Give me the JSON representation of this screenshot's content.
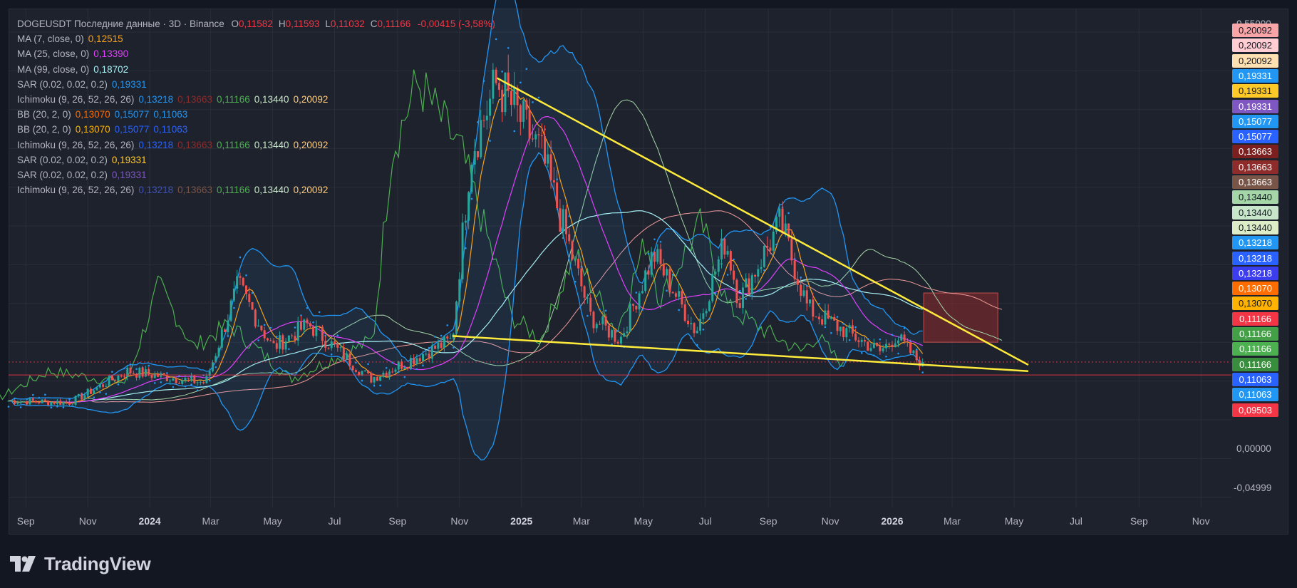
{
  "header": {
    "symbol_line": "DOGEUSDT Последние данные · 3D · Binance",
    "ohlc": [
      {
        "label": "O",
        "value": "0,11582"
      },
      {
        "label": "H",
        "value": "0,11593"
      },
      {
        "label": "L",
        "value": "0,11032"
      },
      {
        "label": "C",
        "value": "0,11166"
      }
    ],
    "change": "-0,00415 (-3,58%)",
    "change_color": "#f23645"
  },
  "indicators": [
    {
      "name": "MA (7, close, 0)",
      "values": [
        {
          "v": "0,12515",
          "c": "#f7a21b"
        }
      ]
    },
    {
      "name": "MA (25, close, 0)",
      "values": [
        {
          "v": "0,13390",
          "c": "#e040fb"
        }
      ]
    },
    {
      "name": "MA (99, close, 0)",
      "values": [
        {
          "v": "0,18702",
          "c": "#a5f0f5"
        }
      ]
    },
    {
      "name": "SAR (0.02, 0.02, 0.2)",
      "values": [
        {
          "v": "0,19331",
          "c": "#2196f3"
        }
      ]
    },
    {
      "name": "Ichimoku (9, 26, 52, 26, 26)",
      "values": [
        {
          "v": "0,13218",
          "c": "#2196f3"
        },
        {
          "v": "0,13663",
          "c": "#8e2b2b"
        },
        {
          "v": "0,11166",
          "c": "#4caf50"
        },
        {
          "v": "0,13440",
          "c": "#c8e6c9"
        },
        {
          "v": "0,20092",
          "c": "#ffcc80"
        }
      ]
    },
    {
      "name": "BB (20, 2, 0)",
      "values": [
        {
          "v": "0,13070",
          "c": "#ff6d00"
        },
        {
          "v": "0,15077",
          "c": "#2196f3"
        },
        {
          "v": "0,11063",
          "c": "#2196f3"
        }
      ]
    },
    {
      "name": "BB (20, 2, 0)",
      "values": [
        {
          "v": "0,13070",
          "c": "#ffb300"
        },
        {
          "v": "0,15077",
          "c": "#2962ff"
        },
        {
          "v": "0,11063",
          "c": "#2962ff"
        }
      ]
    },
    {
      "name": "Ichimoku (9, 26, 52, 26, 26)",
      "values": [
        {
          "v": "0,13218",
          "c": "#2962ff"
        },
        {
          "v": "0,13663",
          "c": "#8e2b2b"
        },
        {
          "v": "0,11166",
          "c": "#4caf50"
        },
        {
          "v": "0,13440",
          "c": "#c8e6c9"
        },
        {
          "v": "0,20092",
          "c": "#ffcc80"
        }
      ]
    },
    {
      "name": "SAR (0.02, 0.02, 0.2)",
      "values": [
        {
          "v": "0,19331",
          "c": "#ffca28"
        }
      ]
    },
    {
      "name": "SAR (0.02, 0.02, 0.2)",
      "values": [
        {
          "v": "0,19331",
          "c": "#7e57c2"
        }
      ]
    },
    {
      "name": "Ichimoku (9, 26, 52, 26, 26)",
      "values": [
        {
          "v": "0,13218",
          "c": "#3f51b5"
        },
        {
          "v": "0,13663",
          "c": "#795548"
        },
        {
          "v": "0,11166",
          "c": "#4caf50"
        },
        {
          "v": "0,13440",
          "c": "#c8e6c9"
        },
        {
          "v": "0,20092",
          "c": "#ffcc80"
        }
      ]
    }
  ],
  "price_axis": {
    "top_label": "0,55000",
    "labels": [
      {
        "text": "0,00000",
        "value": 0.0
      },
      {
        "text": "-0,04999",
        "value": -0.05
      }
    ],
    "tags": [
      {
        "text": "0,20092",
        "bg": "#f8a5a8",
        "fg": "#131722"
      },
      {
        "text": "0,20092",
        "bg": "#ffcdd2",
        "fg": "#131722"
      },
      {
        "text": "0,20092",
        "bg": "#ffe0b2",
        "fg": "#131722"
      },
      {
        "text": "0,19331",
        "bg": "#2196f3",
        "fg": "#ffffff"
      },
      {
        "text": "0,19331",
        "bg": "#ffca28",
        "fg": "#131722"
      },
      {
        "text": "0,19331",
        "bg": "#7e57c2",
        "fg": "#ffffff"
      },
      {
        "text": "0,15077",
        "bg": "#2196f3",
        "fg": "#ffffff"
      },
      {
        "text": "0,15077",
        "bg": "#2962ff",
        "fg": "#ffffff"
      },
      {
        "text": "0,13663",
        "bg": "#7b1f1f",
        "fg": "#ffffff"
      },
      {
        "text": "0,13663",
        "bg": "#8e2b2b",
        "fg": "#ffffff"
      },
      {
        "text": "0,13663",
        "bg": "#795548",
        "fg": "#ffffff"
      },
      {
        "text": "0,13440",
        "bg": "#a5d6a7",
        "fg": "#131722"
      },
      {
        "text": "0,13440",
        "bg": "#c8e6c9",
        "fg": "#131722"
      },
      {
        "text": "0,13440",
        "bg": "#dcedc8",
        "fg": "#131722"
      },
      {
        "text": "0,13218",
        "bg": "#2196f3",
        "fg": "#ffffff"
      },
      {
        "text": "0,13218",
        "bg": "#2962ff",
        "fg": "#ffffff"
      },
      {
        "text": "0,13218",
        "bg": "#3d3df0",
        "fg": "#ffffff"
      },
      {
        "text": "0,13070",
        "bg": "#ff6d00",
        "fg": "#ffffff"
      },
      {
        "text": "0,13070",
        "bg": "#ffb300",
        "fg": "#131722"
      },
      {
        "text": "0,11166",
        "bg": "#f23645",
        "fg": "#ffffff"
      },
      {
        "text": "0,11166",
        "bg": "#43a047",
        "fg": "#ffffff"
      },
      {
        "text": "0,11166",
        "bg": "#4caf50",
        "fg": "#ffffff"
      },
      {
        "text": "0,11166",
        "bg": "#388e3c",
        "fg": "#ffffff"
      },
      {
        "text": "0,11063",
        "bg": "#2962ff",
        "fg": "#ffffff"
      },
      {
        "text": "0,11063",
        "bg": "#2196f3",
        "fg": "#ffffff"
      },
      {
        "text": "0,09503",
        "bg": "#f23645",
        "fg": "#ffffff"
      }
    ]
  },
  "time_axis": [
    {
      "label": "Sep",
      "bold": false
    },
    {
      "label": "Nov",
      "bold": false
    },
    {
      "label": "2024",
      "bold": true
    },
    {
      "label": "Mar",
      "bold": false
    },
    {
      "label": "May",
      "bold": false
    },
    {
      "label": "Jul",
      "bold": false
    },
    {
      "label": "Sep",
      "bold": false
    },
    {
      "label": "Nov",
      "bold": false
    },
    {
      "label": "2025",
      "bold": true
    },
    {
      "label": "Mar",
      "bold": false
    },
    {
      "label": "May",
      "bold": false
    },
    {
      "label": "Jul",
      "bold": false
    },
    {
      "label": "Sep",
      "bold": false
    },
    {
      "label": "Nov",
      "bold": false
    },
    {
      "label": "2026",
      "bold": true
    },
    {
      "label": "Mar",
      "bold": false
    },
    {
      "label": "May",
      "bold": false
    },
    {
      "label": "Jul",
      "bold": false
    },
    {
      "label": "Sep",
      "bold": false
    },
    {
      "label": "Nov",
      "bold": false
    }
  ],
  "brand": {
    "name": "TradingView"
  },
  "colors": {
    "up": "#26a69a",
    "down": "#ef5350",
    "trendline": "#ffeb3b",
    "background": "#1e222d",
    "grid": "#2a2e39",
    "price_line": "#f23645"
  },
  "chart_data": {
    "type": "candlestick",
    "symbol": "DOGEUSDT",
    "interval": "3D",
    "exchange": "Binance",
    "x_range": [
      "2023-08-15",
      "2026-12-01"
    ],
    "price_range_visible": [
      -0.05,
      0.55
    ],
    "last_price": 0.11166,
    "key_points": [
      {
        "date": "2023-08-15",
        "price": 0.062
      },
      {
        "date": "2023-10-15",
        "price": 0.06
      },
      {
        "date": "2023-12-10",
        "price": 0.1
      },
      {
        "date": "2024-02-25",
        "price": 0.085
      },
      {
        "date": "2024-03-28",
        "price": 0.21
      },
      {
        "date": "2024-05-01",
        "price": 0.13
      },
      {
        "date": "2024-06-05",
        "price": 0.16
      },
      {
        "date": "2024-08-05",
        "price": 0.09
      },
      {
        "date": "2024-10-25",
        "price": 0.14
      },
      {
        "date": "2024-11-12",
        "price": 0.38
      },
      {
        "date": "2024-12-08",
        "price": 0.47
      },
      {
        "date": "2025-01-20",
        "price": 0.38
      },
      {
        "date": "2025-03-10",
        "price": 0.17
      },
      {
        "date": "2025-04-08",
        "price": 0.14
      },
      {
        "date": "2025-05-11",
        "price": 0.25
      },
      {
        "date": "2025-06-22",
        "price": 0.15
      },
      {
        "date": "2025-07-21",
        "price": 0.27
      },
      {
        "date": "2025-08-03",
        "price": 0.19
      },
      {
        "date": "2025-09-13",
        "price": 0.29
      },
      {
        "date": "2025-10-10",
        "price": 0.18
      },
      {
        "date": "2025-11-04",
        "price": 0.16
      },
      {
        "date": "2025-12-20",
        "price": 0.125
      },
      {
        "date": "2026-01-05",
        "price": 0.145
      },
      {
        "date": "2026-01-25",
        "price": 0.115
      },
      {
        "date": "2026-02-01",
        "price": 0.11166
      }
    ],
    "trendlines": [
      {
        "name": "upper",
        "from": {
          "date": "2024-12-08",
          "price": 0.475
        },
        "to": {
          "date": "2026-05-15",
          "price": 0.108
        }
      },
      {
        "name": "lower",
        "from": {
          "date": "2024-10-25",
          "price": 0.145
        },
        "to": {
          "date": "2026-05-15",
          "price": 0.1
        }
      }
    ],
    "ichimoku_cloud": {
      "from": "2026-02-01",
      "to": "2026-04-15",
      "top": 0.2,
      "bottom": 0.137,
      "color": "#8e2b2b"
    },
    "horizontal_lines": [
      {
        "price": 0.095,
        "color": "#f23645"
      },
      {
        "price": 0.11166,
        "color": "#f23645",
        "dotted": true
      }
    ]
  }
}
